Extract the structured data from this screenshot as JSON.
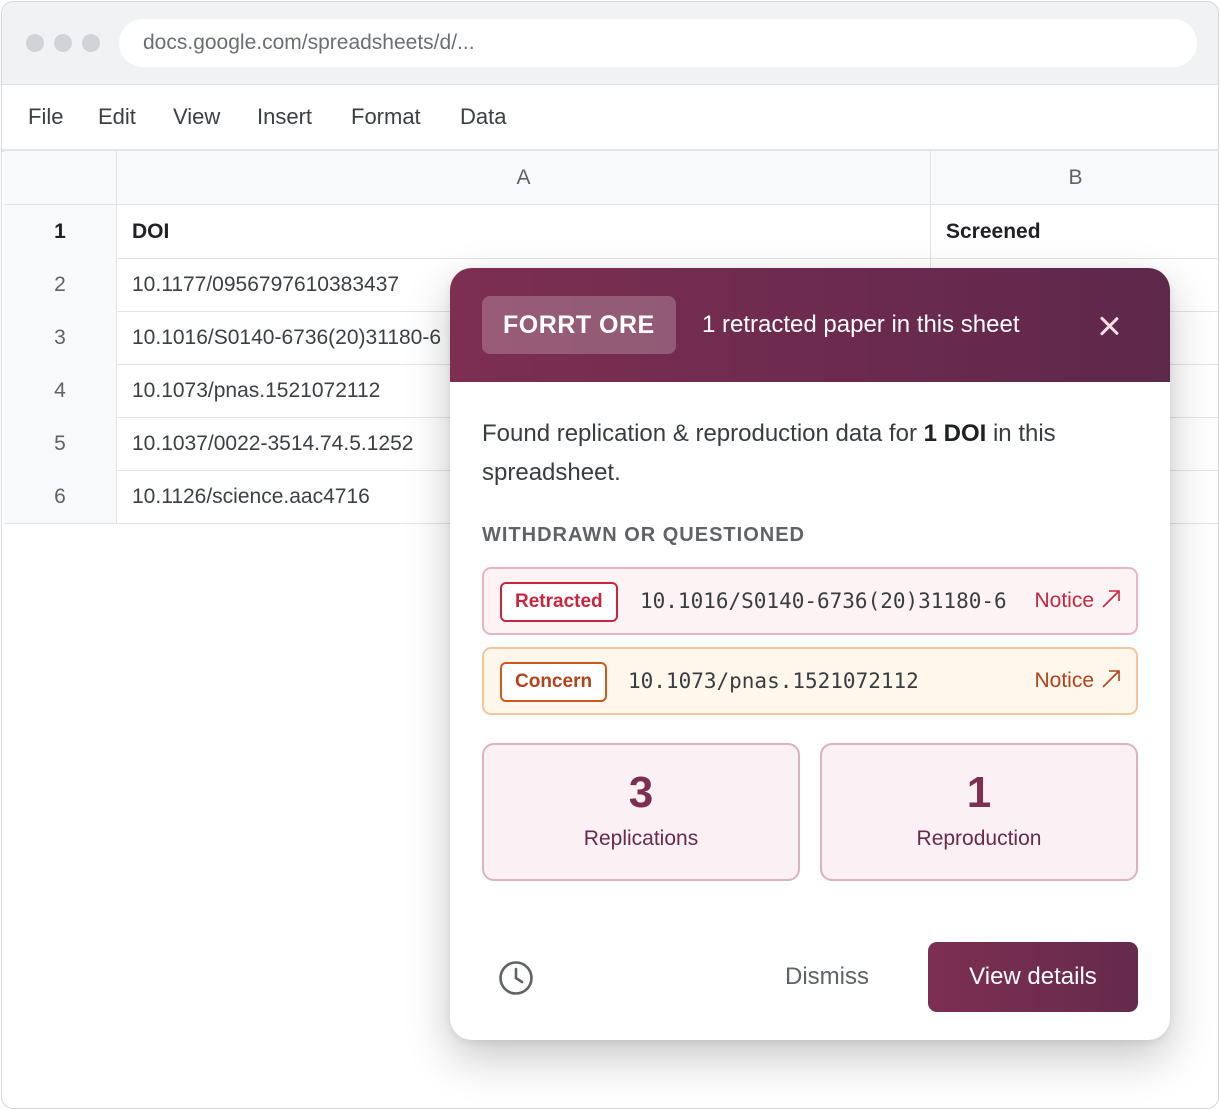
{
  "browser": {
    "url": "docs.google.com/spreadsheets/d/..."
  },
  "menu": [
    "File",
    "Edit",
    "View",
    "Insert",
    "Format",
    "Data"
  ],
  "sheet": {
    "columns": [
      "",
      "A",
      "B"
    ],
    "rows": [
      {
        "num": "1",
        "a": "DOI",
        "b": "Screened"
      },
      {
        "num": "2",
        "a": "10.1177/0956797610383437",
        "b": ""
      },
      {
        "num": "3",
        "a": "10.1016/S0140-6736(20)31180-6",
        "b": ""
      },
      {
        "num": "4",
        "a": "10.1073/pnas.1521072112",
        "b": ""
      },
      {
        "num": "5",
        "a": "10.1037/0022-3514.74.5.1252",
        "b": ""
      },
      {
        "num": "6",
        "a": "10.1126/science.aac4716",
        "b": ""
      }
    ]
  },
  "popup": {
    "brand": "FORRT ORE",
    "title": "1 retracted paper in this sheet",
    "lead_prefix": "Found replication & reproduction data for ",
    "lead_bold": "1 DOI",
    "lead_suffix": " in this spreadsheet.",
    "section": "WITHDRAWN OR QUESTIONED",
    "alerts": [
      {
        "tag": "Retracted",
        "doi": "10.1016/S0140-6736(20)31180-6",
        "link": "Notice",
        "color": "#c8263f"
      },
      {
        "tag": "Concern",
        "doi": "10.1073/pnas.1521072112",
        "link": "Notice",
        "color": "#b2431a"
      }
    ],
    "stats": [
      {
        "value": "3",
        "label": "Replications"
      },
      {
        "value": "1",
        "label": "Reproduction"
      }
    ],
    "dismiss": "Dismiss",
    "view": "View details",
    "accent": "#7d2f52"
  }
}
